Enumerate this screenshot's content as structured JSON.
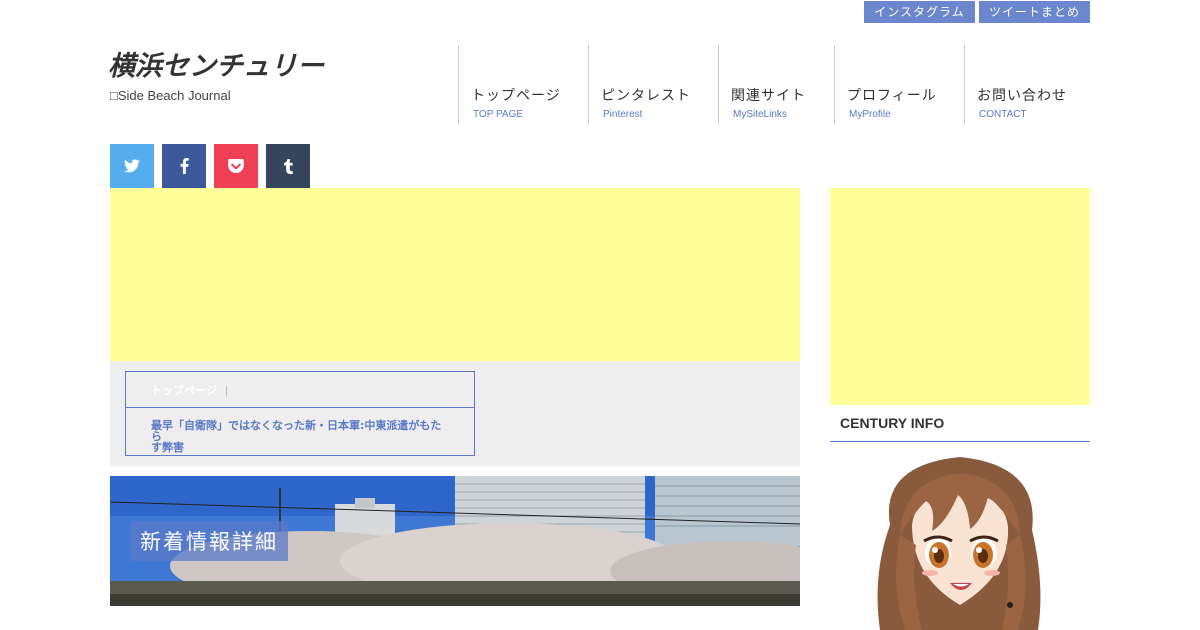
{
  "header": {
    "top_links": [
      "インスタグラム",
      "ツイートまとめ"
    ],
    "site_title": "横浜センチュリー",
    "site_subtitle": "□Side Beach Journal"
  },
  "nav": [
    {
      "label": "トップページ",
      "sub": "TOP PAGE"
    },
    {
      "label": "ピンタレスト",
      "sub": "Pinterest"
    },
    {
      "label": "関連サイト",
      "sub": "MySiteLinks"
    },
    {
      "label": "プロフィール",
      "sub": "MyProfile"
    },
    {
      "label": "お問い合わせ",
      "sub": "CONTACT"
    }
  ],
  "share": {
    "twitter_icon": "twitter-icon",
    "facebook_icon": "facebook-icon",
    "pocket_icon": "pocket-icon",
    "tumblr_icon": "tumblr-icon"
  },
  "breadcrumb": {
    "home": "トップページ",
    "separator": "|",
    "title_line1": "最早「自衛隊」ではなくなった新・日本軍:中東派遣がもたら",
    "title_line2": "す弊害"
  },
  "banner": {
    "label": "新着情報詳細"
  },
  "sidebar": {
    "heading": "CENTURY INFO"
  },
  "colors": {
    "accent": "#5a79c9",
    "ad_yellow": "#ffff99",
    "twitter": "#55acee",
    "facebook": "#3b5998",
    "pocket": "#ef4056",
    "tumblr": "#35465c"
  }
}
